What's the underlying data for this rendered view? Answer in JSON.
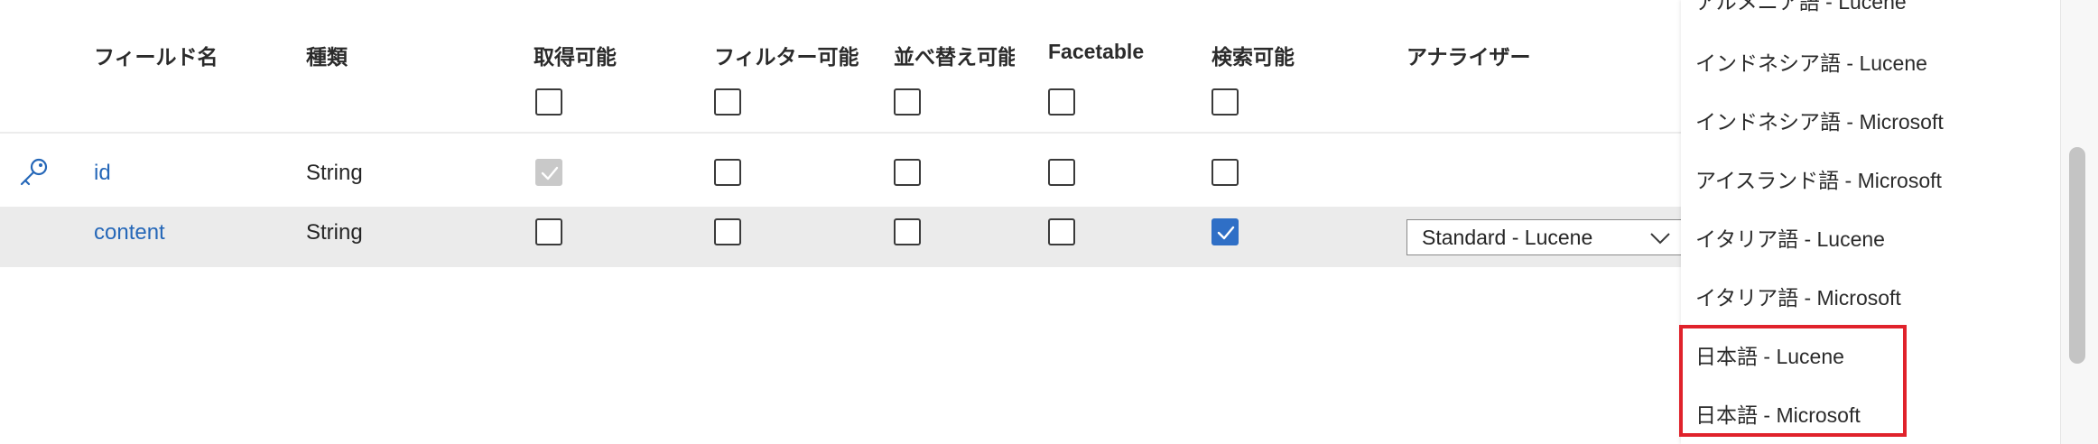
{
  "columns": {
    "field_name": "フィールド名",
    "type": "種類",
    "retrievable": "取得可能",
    "filterable": "フィルター可能",
    "sortable": "並べ替え可能",
    "facetable": "Facetable",
    "searchable": "検索可能",
    "analyzer": "アナライザー"
  },
  "header_checkboxes": {
    "retrievable": false,
    "filterable": false,
    "sortable": false,
    "facetable": false,
    "searchable": false
  },
  "rows": [
    {
      "key_icon": "key-icon",
      "name": "id",
      "type": "String",
      "retrievable": true,
      "retrievable_disabled": true,
      "filterable": false,
      "sortable": false,
      "facetable": false,
      "searchable": false
    },
    {
      "name": "content",
      "type": "String",
      "retrievable": false,
      "filterable": false,
      "sortable": false,
      "facetable": false,
      "searchable": true,
      "analyzer": "Standard - Lucene"
    }
  ],
  "dropdown": {
    "options": [
      "アルメニア語 - Lucene",
      "インドネシア語 - Lucene",
      "インドネシア語 - Microsoft",
      "アイスランド語 - Microsoft",
      "イタリア語 - Lucene",
      "イタリア語 - Microsoft",
      "日本語 - Lucene",
      "日本語 - Microsoft"
    ],
    "highlighted_count": 2
  },
  "icons": {
    "key": "key-icon",
    "checkmark": "checkmark-icon",
    "chevron": "chevron-down-icon"
  },
  "colors": {
    "link": "#2567b8",
    "checked": "#2f6fc6",
    "disabled": "#c9c9c9",
    "row_highlight": "#ebebeb",
    "annotation": "#e0222b"
  }
}
